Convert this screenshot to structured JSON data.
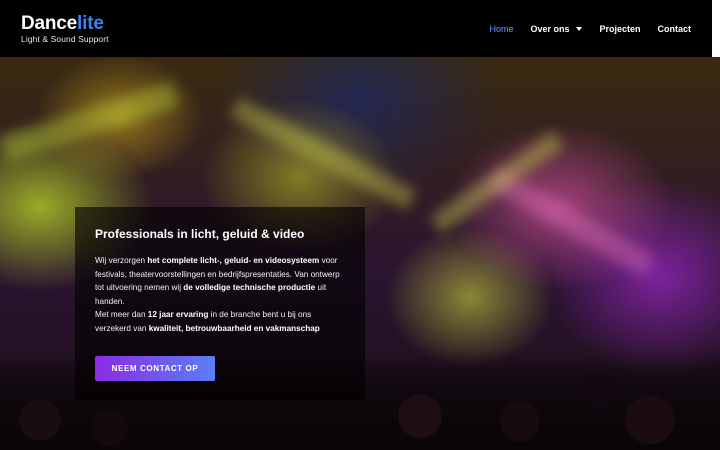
{
  "logo": {
    "part1": "Dance",
    "part2": "lite",
    "tagline": "Light & Sound Support"
  },
  "nav": {
    "home": "Home",
    "about": "Over ons",
    "projects": "Projecten",
    "contact": "Contact"
  },
  "hero": {
    "title": "Professionals in licht, geluid & video",
    "p1_a": "Wij verzorgen ",
    "p1_b": "het complete licht-, geluid- en videosysteem",
    "p1_c": " voor festivals, theatervoorstellingen en bedrijfspresentaties. Van ontwerp tot uitvoering nemen wij ",
    "p1_d": "de volledige technische productie",
    "p1_e": " uit handen.",
    "p2_a": "Met meer dan ",
    "p2_b": "12 jaar ervaring",
    "p2_c": " in de branche bent u bij ons verzekerd van ",
    "p2_d": "kwaliteit, betrouwbaarheid en vakmanschap",
    "cta": "NEEM CONTACT OP"
  },
  "colors": {
    "accent": "#3b82f6",
    "active_nav": "#5b9dff",
    "cta_start": "#8a2be2",
    "cta_end": "#5b7ef5"
  }
}
